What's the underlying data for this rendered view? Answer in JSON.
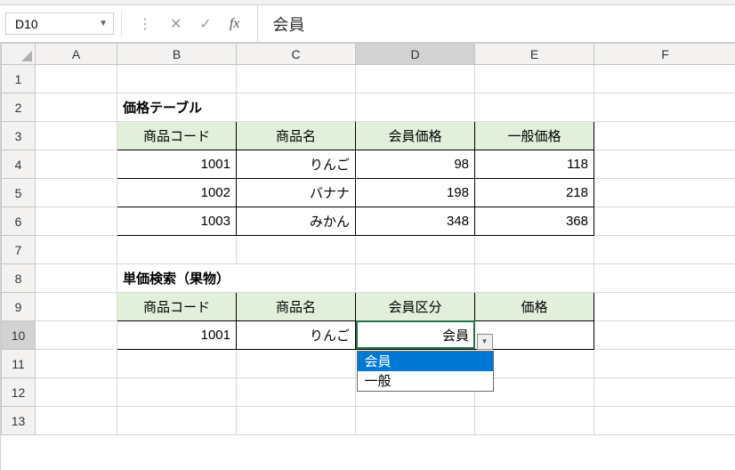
{
  "formula_bar": {
    "namebox": "D10",
    "formula": "会員"
  },
  "columns": [
    "A",
    "B",
    "C",
    "D",
    "E",
    "F"
  ],
  "rows": [
    "1",
    "2",
    "3",
    "4",
    "5",
    "6",
    "7",
    "8",
    "9",
    "10",
    "11",
    "12",
    "13"
  ],
  "active": {
    "col": "D",
    "row": "10"
  },
  "titles": {
    "price_table": "価格テーブル",
    "search_table": "単価検索（果物）"
  },
  "price_table": {
    "headers": {
      "code": "商品コード",
      "name": "商品名",
      "member_price": "会員価格",
      "general_price": "一般価格"
    },
    "rows": [
      {
        "code": "1001",
        "name": "りんご",
        "member_price": "98",
        "general_price": "118"
      },
      {
        "code": "1002",
        "name": "バナナ",
        "member_price": "198",
        "general_price": "218"
      },
      {
        "code": "1003",
        "name": "みかん",
        "member_price": "348",
        "general_price": "368"
      }
    ]
  },
  "search_table": {
    "headers": {
      "code": "商品コード",
      "name": "商品名",
      "member_class": "会員区分",
      "price": "価格"
    },
    "row": {
      "code": "1001",
      "name": "りんご",
      "member_class": "会員",
      "price": ""
    }
  },
  "dropdown": {
    "options": [
      "会員",
      "一般"
    ],
    "selected_index": 0
  },
  "chart_data": {
    "type": "table",
    "title": "価格テーブル",
    "columns": [
      "商品コード",
      "商品名",
      "会員価格",
      "一般価格"
    ],
    "rows": [
      [
        "1001",
        "りんご",
        98,
        118
      ],
      [
        "1002",
        "バナナ",
        198,
        218
      ],
      [
        "1003",
        "みかん",
        348,
        368
      ]
    ]
  }
}
